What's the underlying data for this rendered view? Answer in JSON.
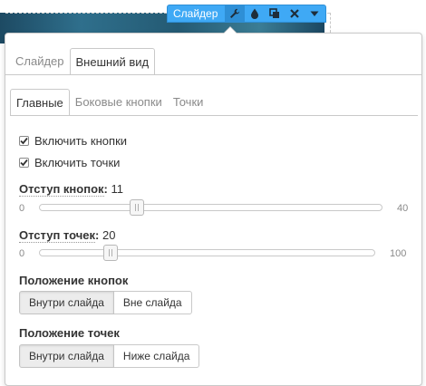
{
  "toolbar": {
    "title": "Слайдер",
    "buttons": [
      {
        "icon": "wrench-icon",
        "active": true
      },
      {
        "icon": "drop-icon",
        "active": false
      },
      {
        "icon": "copy-icon",
        "active": false
      },
      {
        "icon": "close-icon",
        "active": false
      },
      {
        "icon": "caret-down-icon",
        "active": false
      }
    ]
  },
  "tabs": {
    "top": [
      {
        "label": "Слайдер",
        "active": false
      },
      {
        "label": "Внешний вид",
        "active": true
      }
    ],
    "sub": [
      {
        "label": "Главные",
        "active": true
      },
      {
        "label": "Боковые кнопки",
        "active": false
      },
      {
        "label": "Точки",
        "active": false
      }
    ]
  },
  "checkboxes": [
    {
      "label": "Включить кнопки",
      "checked": true
    },
    {
      "label": "Включить точки",
      "checked": true
    }
  ],
  "sliders": [
    {
      "label": "Отступ кнопок",
      "value": "11",
      "min": "0",
      "max": "40",
      "fraction": 0.275
    },
    {
      "label": "Отступ точек",
      "value": "20",
      "min": "0",
      "max": "100",
      "fraction": 0.2
    }
  ],
  "button_position": {
    "heading": "Положение кнопок",
    "options": [
      {
        "label": "Внутри слайда",
        "active": true
      },
      {
        "label": "Вне слайда",
        "active": false
      }
    ]
  },
  "dot_position": {
    "heading": "Положение точек",
    "options": [
      {
        "label": "Внутри слайда",
        "active": true
      },
      {
        "label": "Ниже слайда",
        "active": false
      }
    ]
  },
  "colors": {
    "toolbar_bg": "#3fa9f5",
    "panel_border": "#c9c9c9",
    "active_segment": "#ececec"
  }
}
